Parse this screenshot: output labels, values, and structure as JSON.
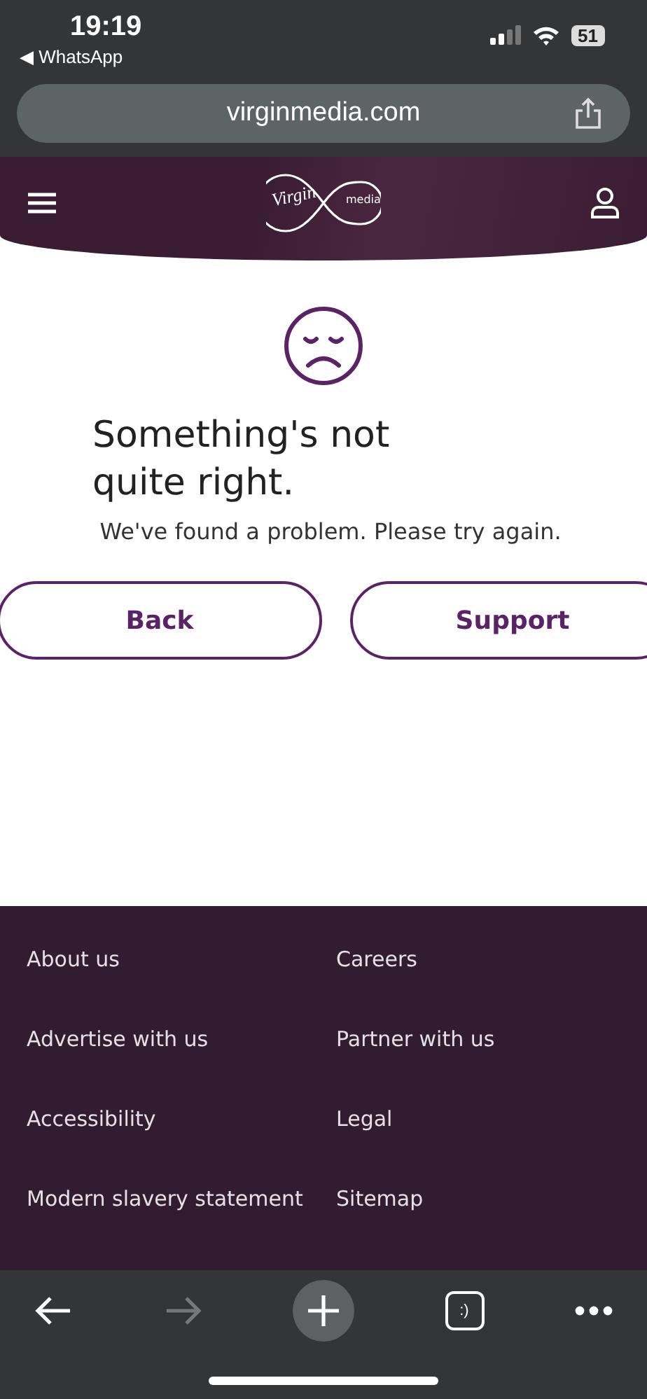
{
  "status_bar": {
    "time": "19:19",
    "back_app": "◀ WhatsApp",
    "battery": "51"
  },
  "address_bar": {
    "url": "virginmedia.com"
  },
  "header": {
    "logo": {
      "script": "Virgin",
      "word": "media"
    }
  },
  "error": {
    "title": "Something's not quite right.",
    "message": "We've found a problem. Please try again.",
    "buttons": [
      "Back",
      "Support"
    ]
  },
  "footer": {
    "links": [
      "About us",
      "Careers",
      "Advertise with us",
      "Partner with us",
      "Accessibility",
      "Legal",
      "Modern slavery statement",
      "Sitemap"
    ]
  },
  "toolbar": {
    "items": [
      {
        "kind": "back",
        "disabled": false
      },
      {
        "kind": "forward",
        "disabled": true
      },
      {
        "kind": "new-tab",
        "disabled": false
      },
      {
        "kind": "tabs",
        "label": ":)",
        "disabled": false
      },
      {
        "kind": "more",
        "disabled": false
      }
    ]
  }
}
